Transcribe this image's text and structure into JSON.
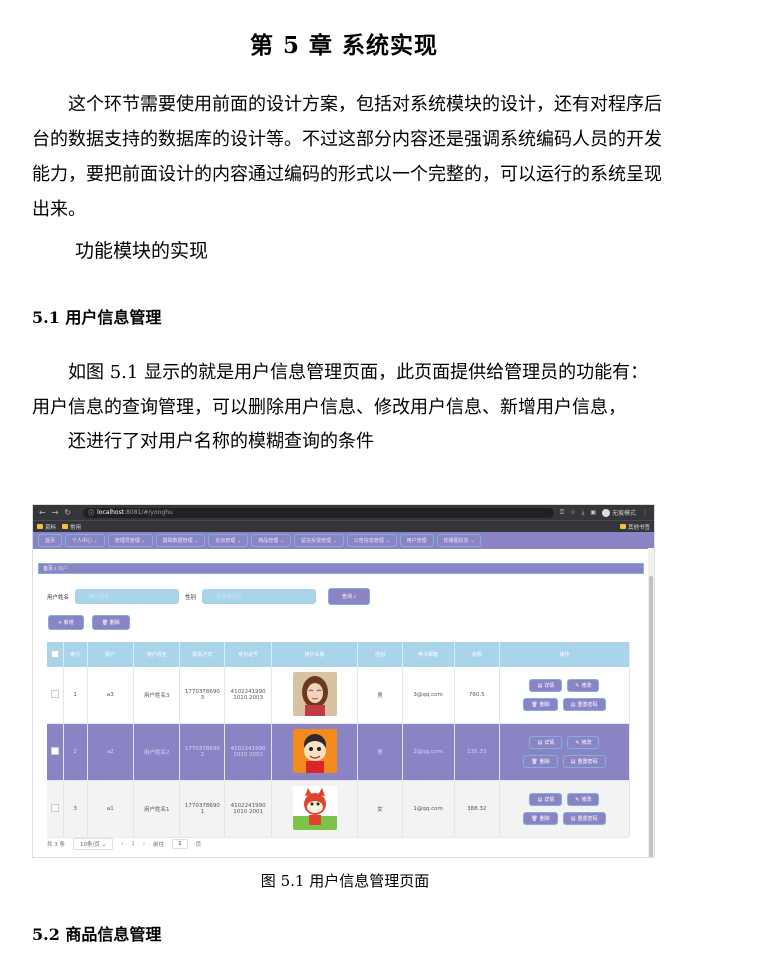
{
  "chapter_title": "第 5 章  系统实现",
  "intro_paragraph": "这个环节需要使用前面的设计方案，包括对系统模块的设计，还有对程序后台的数据支持的数据库的设计等。不过这部分内容还是强调系统编码人员的开发能力，要把前面设计的内容通过编码的形式以一个完整的，可以运行的系统呈现出来。",
  "subheading": "功能模块的实现",
  "section_1_title": "5.1 用户信息管理",
  "section_1_para": "如图 5.1 显示的就是用户信息管理页面，此页面提供给管理员的功能有：用户信息的查询管理，可以删除用户信息、修改用户信息、新增用户信息，",
  "section_1_para2": "还进行了对用户名称的模糊查询的条件",
  "figure_caption": "图 5.1  用户信息管理页面",
  "section_2_title": "5.2  商品信息管理",
  "browser": {
    "url_host": "localhost",
    "url_path": ":8081/#/yonghu",
    "incognito": "无痕模式",
    "bookmarks": [
      "资料",
      "常用"
    ],
    "other_bookmarks": "其他书签"
  },
  "app": {
    "menu": [
      "首页",
      "个人中心",
      "管理员管理",
      "基础数据管理",
      "论坛管理",
      "商品管理",
      "留言反馈管理",
      "公告信息管理",
      "用户管理",
      "轮播图信息"
    ],
    "breadcrumb": [
      "首页",
      "用户"
    ],
    "search": {
      "name_label": "用户姓名",
      "name_placeholder": "用户姓名",
      "gender_label": "性别",
      "gender_placeholder": "请选择性别",
      "button": "查询"
    },
    "actions": [
      "新增",
      "删除"
    ],
    "columns": [
      "索引",
      "账户",
      "用户姓名",
      "联系方式",
      "身份证号",
      "用户头像",
      "性别",
      "电子邮箱",
      "余额",
      "操作"
    ],
    "rows": [
      {
        "index": "1",
        "account": "a3",
        "name": "用户姓名3",
        "phone": "17703786903",
        "id_card": "41022419901010 2003",
        "gender": "男",
        "email": "3@qq.com",
        "balance": "760.5"
      },
      {
        "index": "2",
        "account": "a2",
        "name": "用户姓名2",
        "phone": "17703786902",
        "id_card": "41022419901010 2002",
        "gender": "男",
        "email": "2@qq.com",
        "balance": "135.33"
      },
      {
        "index": "3",
        "account": "a1",
        "name": "用户姓名1",
        "phone": "17703786901",
        "id_card": "41022419901010 2001",
        "gender": "女",
        "email": "1@qq.com",
        "balance": "388.32"
      }
    ],
    "row_buttons": [
      "详情",
      "修改",
      "删除",
      "重置密码"
    ],
    "pager": {
      "total": "共 3 条",
      "page_size": "10条/页",
      "current": "1",
      "goto_label": "前往",
      "goto_value": "1",
      "page_unit": "页"
    }
  }
}
